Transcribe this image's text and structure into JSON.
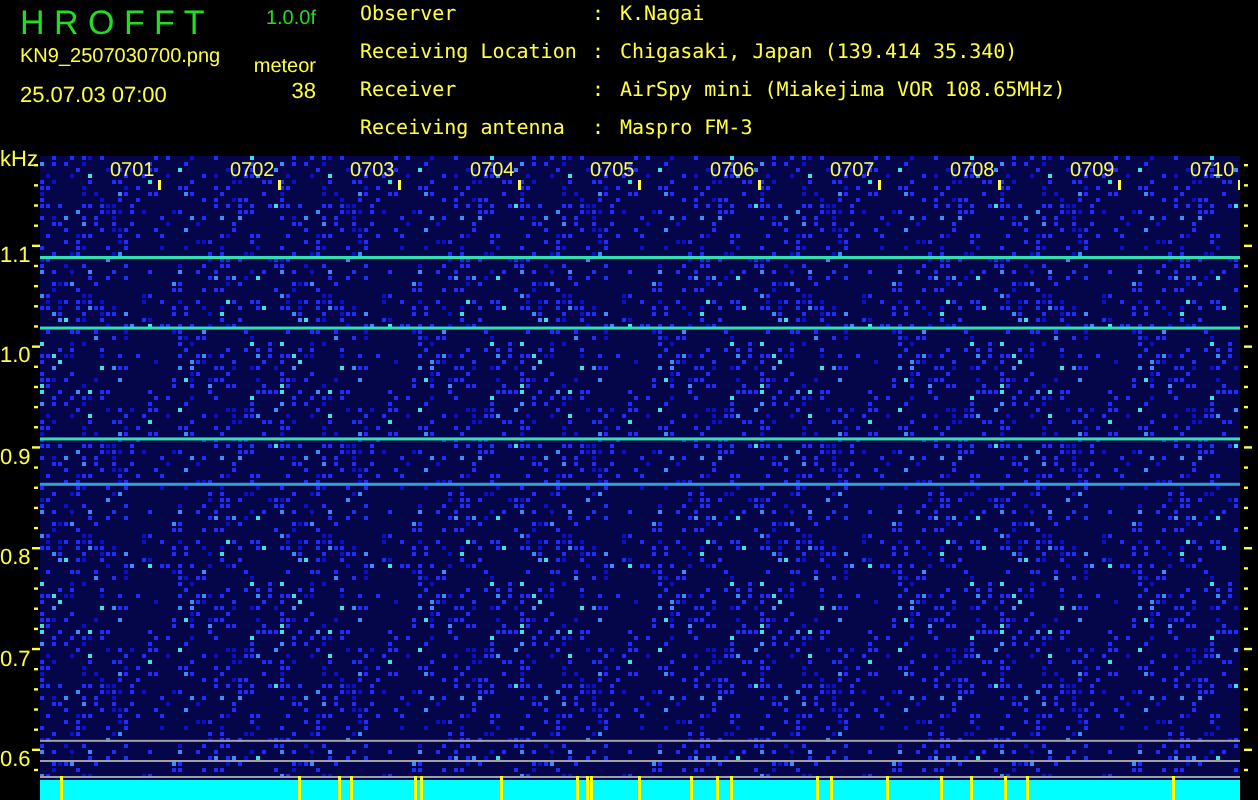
{
  "app": {
    "title": "H R O F F T",
    "version": "1.0.0f",
    "filename": "KN9_2507030700.png",
    "timestamp": "25.07.03 07:00",
    "count_label": "meteor",
    "count": "38"
  },
  "info": [
    {
      "label": "Observer",
      "separator": ":",
      "value": "K.Nagai"
    },
    {
      "label": "Receiving Location",
      "separator": ":",
      "value": "Chigasaki, Japan (139.414 35.340)"
    },
    {
      "label": "Receiver",
      "separator": ":",
      "value": "AirSpy mini (Miakejima VOR 108.65MHz)"
    },
    {
      "label": "Receiving antenna",
      "separator": ":",
      "value": "Maspro FM-3"
    }
  ],
  "spectrogram": {
    "unit": "kHz",
    "time_labels": [
      "0701",
      "0702",
      "0703",
      "0704",
      "0705",
      "0706",
      "0707",
      "0708",
      "0709",
      "0710"
    ],
    "freq_labels": [
      "1.1",
      "1.0",
      "0.9",
      "0.8",
      "0.7",
      "0.6"
    ]
  }
}
